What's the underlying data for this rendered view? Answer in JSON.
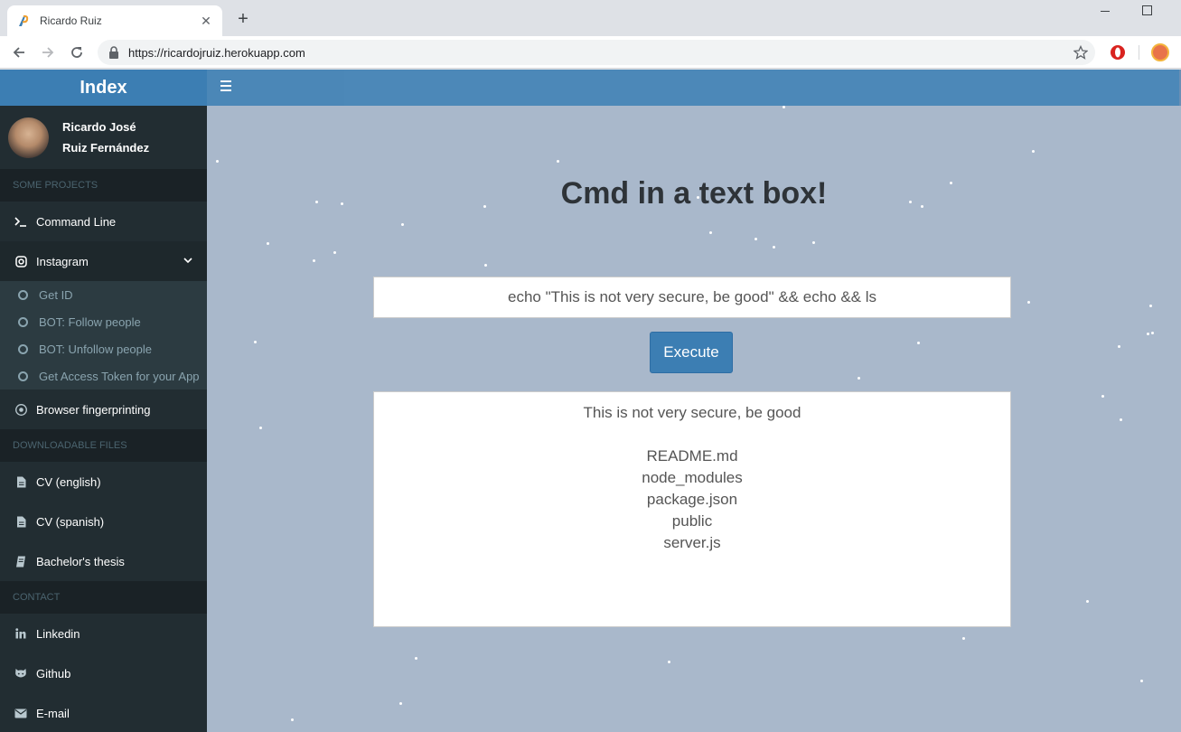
{
  "browser": {
    "tab_title": "Ricardo Ruiz",
    "url": "https://ricardojruiz.herokuapp.com",
    "new_tab_label": "+",
    "close_label": "✕"
  },
  "sidebar": {
    "brand": "Index",
    "user": {
      "first_line": "Ricardo José",
      "second_line": "Ruiz Fernández"
    },
    "sections": [
      "SOME PROJECTS",
      "DOWNLOADABLE FILES",
      "CONTACT"
    ],
    "projects": {
      "command_line": "Command Line",
      "instagram": "Instagram",
      "instagram_sub": [
        "Get ID",
        "BOT: Follow people",
        "BOT: Unfollow people",
        "Get Access Token for your App"
      ],
      "fingerprinting": "Browser fingerprinting"
    },
    "files": [
      "CV (english)",
      "CV (spanish)",
      "Bachelor's thesis"
    ],
    "contact": [
      "Linkedin",
      "Github",
      "E-mail"
    ]
  },
  "main": {
    "title": "Cmd in a text box!",
    "command_value": "echo \"This is not very secure, be good\" && echo && ls",
    "execute_label": "Execute",
    "output_lines": [
      "This is not very secure, be good",
      "",
      "README.md",
      "node_modules",
      "package.json",
      "public",
      "server.js"
    ]
  },
  "colors": {
    "accent": "#3c7eb3",
    "sidebar_bg": "#222d32",
    "content_bg": "#a9b8cb"
  }
}
